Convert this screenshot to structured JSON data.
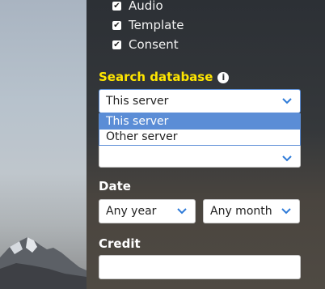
{
  "checkboxes": [
    {
      "label": "Audio",
      "checked": "✔"
    },
    {
      "label": "Template",
      "checked": "✔"
    },
    {
      "label": "Consent",
      "checked": "✔"
    }
  ],
  "search_database": {
    "title": "Search database",
    "selected": "This server",
    "options": [
      "This server",
      "Other server"
    ]
  },
  "date": {
    "title": "Date",
    "year_value": "Any year",
    "month_value": "Any month"
  },
  "credit": {
    "title": "Credit",
    "value": ""
  },
  "colors": {
    "accent": "#ffe600",
    "selection": "#5b8dd6",
    "chevron": "#2f7bd8"
  }
}
